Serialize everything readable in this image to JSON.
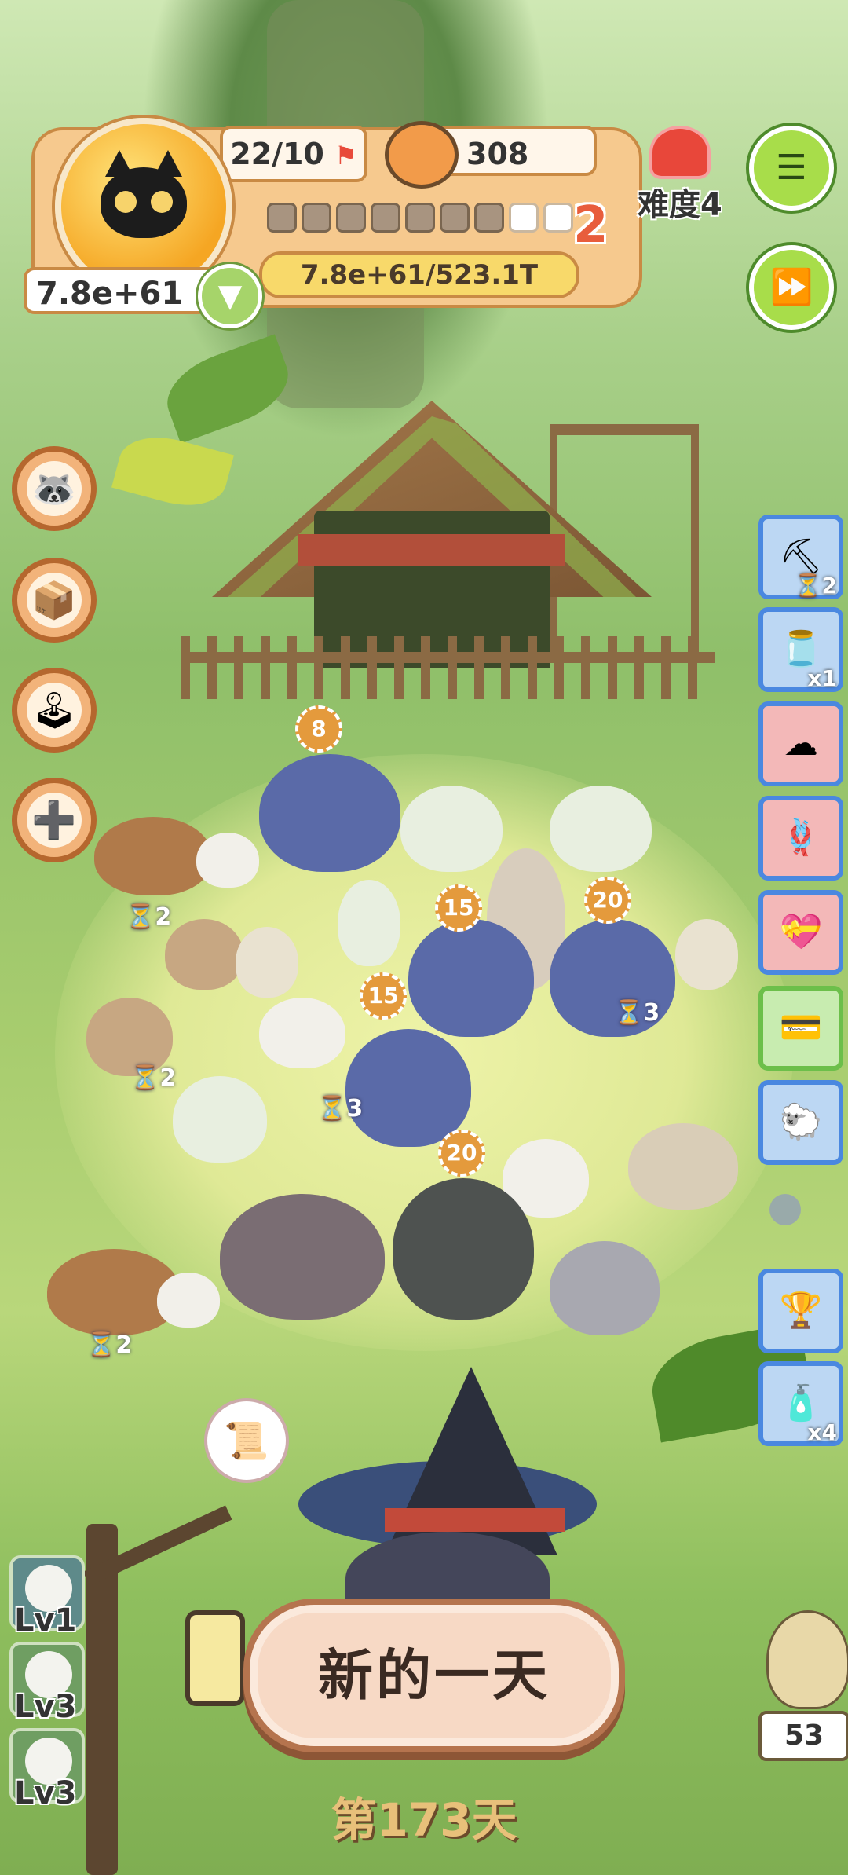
{
  "header": {
    "population": "22/10",
    "food": "308",
    "coins": "7.8e+61",
    "xp_text": "7.8e+61/523.1T",
    "level": "2",
    "progress_filled": 7,
    "progress_total": 9
  },
  "difficulty": {
    "label": "难度4"
  },
  "buttons": {
    "menu_icon": "menu-list-icon",
    "fast_forward_icon": "fast-forward-icon"
  },
  "left_menu": [
    {
      "name": "character",
      "icon": "🦝"
    },
    {
      "name": "box",
      "icon": "📦"
    },
    {
      "name": "joystick",
      "icon": "🕹"
    },
    {
      "name": "medkit",
      "icon": "➕"
    }
  ],
  "side_items": [
    {
      "name": "shovel",
      "icon": "⛏",
      "badge": "⏳2"
    },
    {
      "name": "jar",
      "icon": "🫙",
      "badge": "x1"
    },
    {
      "name": "cloud",
      "icon": "☁",
      "badge": ""
    },
    {
      "name": "rope",
      "icon": "🪢",
      "badge": ""
    },
    {
      "name": "pouch",
      "icon": "💝",
      "badge": ""
    },
    {
      "name": "card",
      "icon": "💳",
      "badge": ""
    },
    {
      "name": "sheep",
      "icon": "🐑",
      "badge": ""
    },
    {
      "name": "trophy",
      "icon": "🏆",
      "badge": ""
    },
    {
      "name": "bottle",
      "icon": "🧴",
      "badge": "x4"
    }
  ],
  "field_badges": {
    "b8": "8",
    "b15a": "15",
    "b15b": "15",
    "b20a": "20",
    "b20b": "20",
    "t2a": "⏳2",
    "t2b": "⏳2",
    "t2c": "⏳2",
    "t3a": "⏳3",
    "t3b": "⏳3"
  },
  "levels": [
    "Lv1",
    "Lv3",
    "Lv3"
  ],
  "main_button": "新的一天",
  "day_label": "第173天",
  "owl_count": "53",
  "colors": {
    "accent": "#f5a623",
    "newday_border": "#b5744e",
    "card_border": "#4a88e0"
  }
}
